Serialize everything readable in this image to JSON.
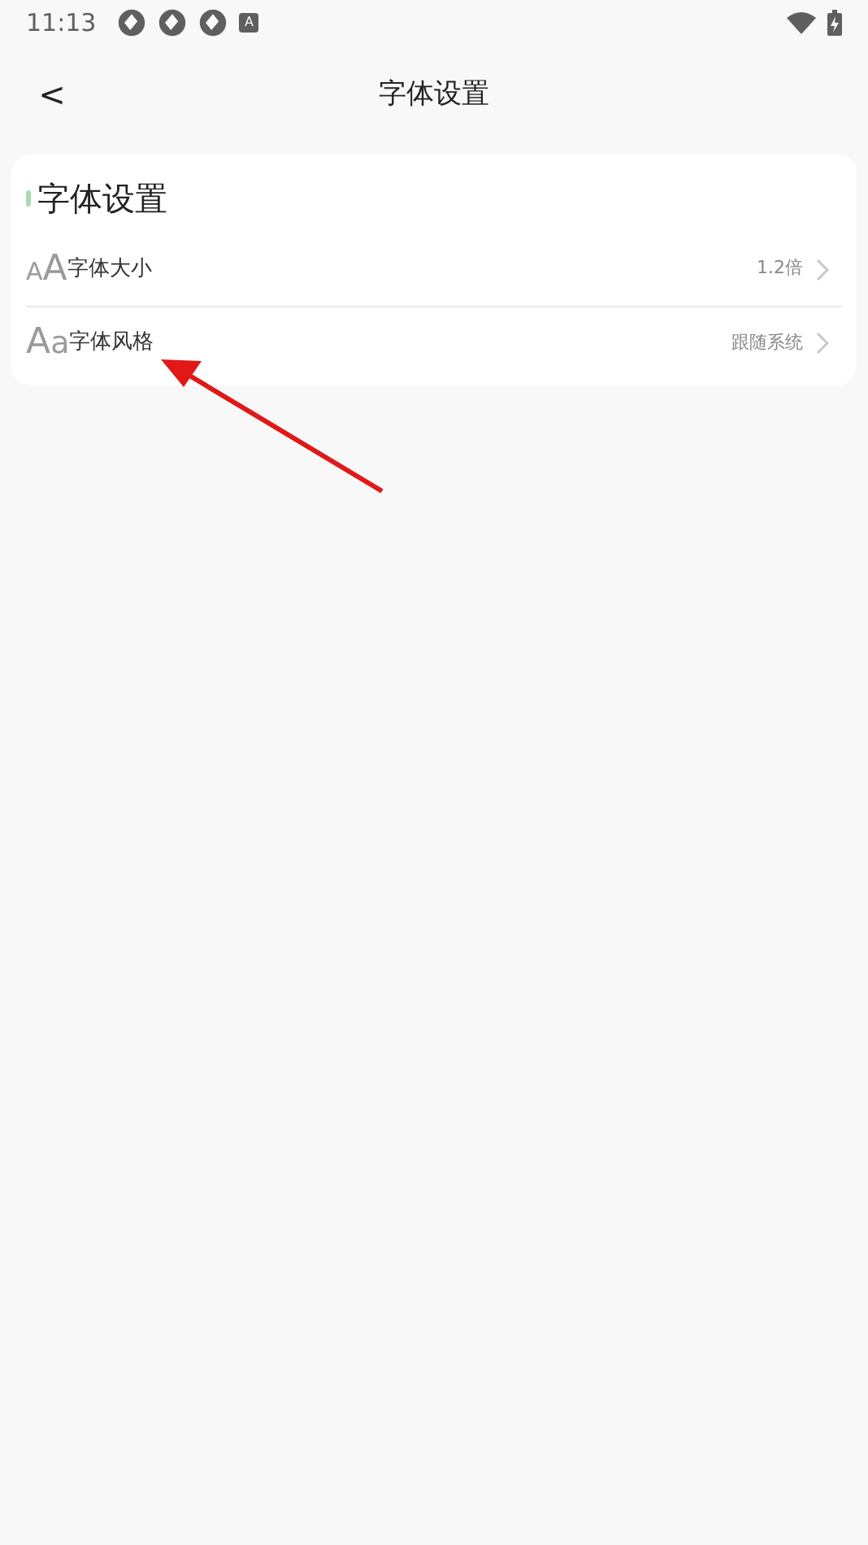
{
  "status_bar": {
    "time": "11:13",
    "badge": "A"
  },
  "header": {
    "back": "<",
    "title": "字体设置"
  },
  "card": {
    "title": "字体设置",
    "rows": [
      {
        "kind": "size",
        "glyph_small": "A",
        "glyph_large": "A",
        "label": "字体大小",
        "value": "1.2倍"
      },
      {
        "kind": "style",
        "glyph_small": "a",
        "glyph_large": "A",
        "label": "字体风格",
        "value": "跟随系统"
      }
    ]
  },
  "annotation": {
    "kind": "arrow"
  }
}
